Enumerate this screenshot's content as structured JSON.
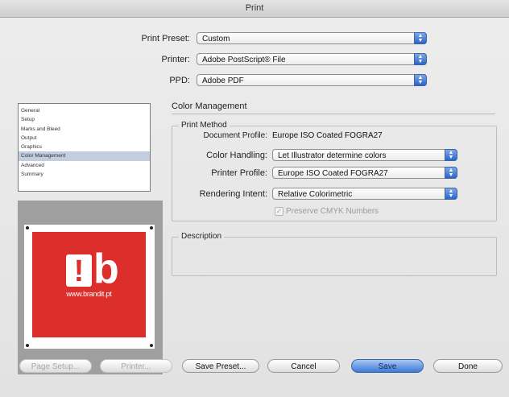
{
  "window": {
    "title": "Print"
  },
  "top_fields": [
    {
      "label": "Print Preset:",
      "value": "Custom"
    },
    {
      "label": "Printer:",
      "value": "Adobe PostScript® File"
    },
    {
      "label": "PPD:",
      "value": "Adobe PDF"
    }
  ],
  "sidebar": {
    "items": [
      "General",
      "Setup",
      "Marks and Bleed",
      "Output",
      "Graphics",
      "Color Management",
      "Advanced",
      "Summary"
    ],
    "selected": "Color Management"
  },
  "preview": {
    "header_text": "",
    "logo_mark": "!",
    "logo_letter": "b",
    "url": "www.brandit.pt",
    "brand_color": "#dc2f2b"
  },
  "panel": {
    "title": "Color Management",
    "print_method": {
      "legend": "Print Method",
      "document_profile_label": "Document Profile:",
      "document_profile_value": "Europe ISO Coated FOGRA27",
      "color_handling_label": "Color Handling:",
      "color_handling_value": "Let Illustrator determine colors",
      "printer_profile_label": "Printer Profile:",
      "printer_profile_value": "Europe ISO Coated FOGRA27",
      "rendering_intent_label": "Rendering Intent:",
      "rendering_intent_value": "Relative Colorimetric",
      "preserve_cmyk_label": "Preserve CMYK Numbers",
      "preserve_cmyk_checked": true
    },
    "description": {
      "legend": "Description"
    }
  },
  "buttons": {
    "page_setup": "Page Setup...",
    "printer": "Printer...",
    "save_preset": "Save Preset...",
    "cancel": "Cancel",
    "save": "Save",
    "done": "Done"
  }
}
